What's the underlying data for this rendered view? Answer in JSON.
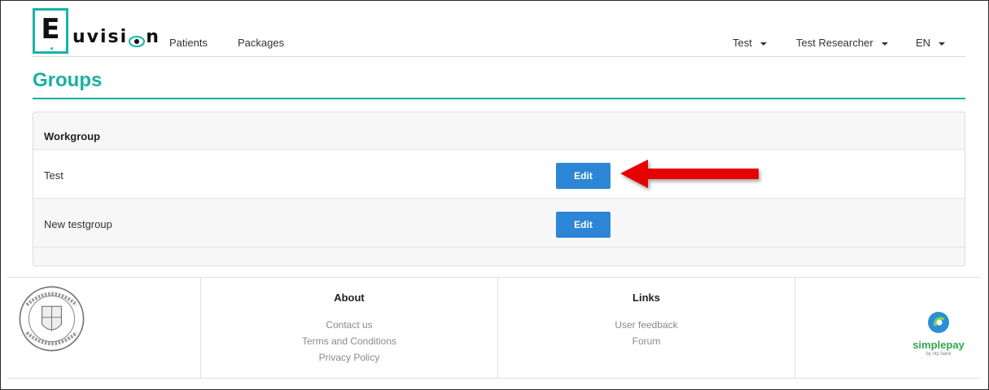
{
  "brand": {
    "logo_letter": "E",
    "logo_word_before": "uvisi",
    "logo_word_after": "n",
    "accent": "#16b5a6"
  },
  "nav": {
    "links": [
      "Patients",
      "Packages"
    ],
    "workgroup_menu": "Test",
    "user_menu": "Test Researcher",
    "language_menu": "EN"
  },
  "page": {
    "title": "Groups"
  },
  "table": {
    "header": "Workgroup",
    "rows": [
      {
        "name": "Test",
        "action": "Edit"
      },
      {
        "name": "New testgroup",
        "action": "Edit"
      }
    ]
  },
  "annotation": {
    "color": "#e60000"
  },
  "footer": {
    "about": {
      "title": "About",
      "links": [
        "Contact us",
        "Terms and Conditions",
        "Privacy Policy"
      ]
    },
    "links": {
      "title": "Links",
      "links": [
        "User feedback",
        "Forum"
      ]
    },
    "payment": {
      "brand": "simplepay",
      "sub": "by otp bank"
    }
  },
  "colors": {
    "primary_button": "#2d86d5",
    "title": "#1ab0a0"
  }
}
